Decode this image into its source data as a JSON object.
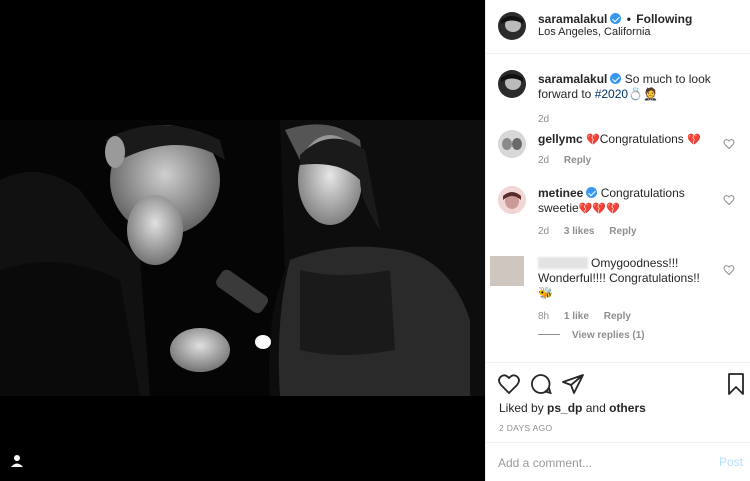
{
  "post": {
    "username": "saramalakul",
    "following_label": "Following",
    "location": "Los Angeles, California"
  },
  "caption": {
    "username": "saramalakul",
    "text": "So much to look forward to",
    "hashtag": "#2020",
    "emoji": "💍🤵",
    "time": "2d"
  },
  "comments": [
    {
      "username": "gellymc",
      "text": "Congratulations",
      "time": "2d",
      "reply_label": "Reply"
    },
    {
      "username": "metinee",
      "text": "Congratulations sweetie",
      "time": "2d",
      "likes_label": "3 likes",
      "reply_label": "Reply"
    },
    {
      "username": "",
      "text": "Omygoodness!!! Wonderful!!!! Congratulations!!",
      "emoji": "🐝",
      "time": "8h",
      "likes_label": "1 like",
      "reply_label": "Reply",
      "view_replies": "View replies (1)"
    }
  ],
  "actions": {
    "liked_by_prefix": "Liked by",
    "liked_by_user": "ps_dp",
    "liked_by_and": "and",
    "liked_by_others": "others",
    "timestamp": "2 DAYS AGO"
  },
  "composer": {
    "placeholder": "Add a comment...",
    "post_label": "Post"
  },
  "colors": {
    "verified": "#3897f0",
    "post_button_disabled": "#b2dffc",
    "meta_gray": "#8e8e8e"
  }
}
